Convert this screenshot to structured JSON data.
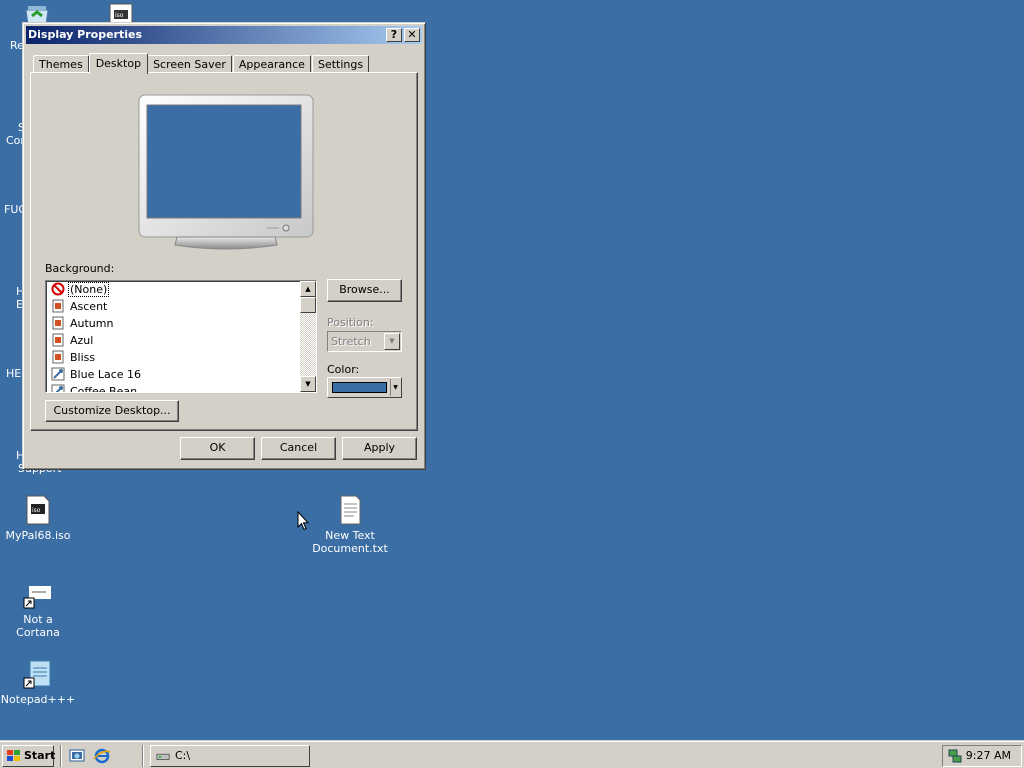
{
  "desktop": {
    "partial_labels": {
      "recycle": "Re",
      "computer_a": "S",
      "computer_b": "Com",
      "fug": "FUG",
      "h_a": "H",
      "h_b": "E",
      "hec": "HEC",
      "help_a": "H",
      "help_b": "Support"
    },
    "icons": {
      "mypal": "MyPal68.iso",
      "newtext_line1": "New Text",
      "newtext_line2": "Document.txt",
      "cortana": "Not a Cortana",
      "notepad": "Notepad+++"
    }
  },
  "window": {
    "title": "Display Properties",
    "help_btn": "?",
    "close_btn": "✕",
    "tabs": [
      "Themes",
      "Desktop",
      "Screen Saver",
      "Appearance",
      "Settings"
    ],
    "active_tab": "Desktop",
    "background_label": "Background:",
    "background_items": [
      {
        "label": "(None)",
        "icon": "none-icon"
      },
      {
        "label": "Ascent",
        "icon": "image-icon"
      },
      {
        "label": "Autumn",
        "icon": "image-icon"
      },
      {
        "label": "Azul",
        "icon": "image-icon"
      },
      {
        "label": "Bliss",
        "icon": "image-icon"
      },
      {
        "label": "Blue Lace 16",
        "icon": "bitmap-icon"
      },
      {
        "label": "Coffee Bean",
        "icon": "bitmap-icon"
      }
    ],
    "selected_background": "(None)",
    "browse_btn": "Browse...",
    "position_label": "Position:",
    "position_value": "Stretch",
    "color_label": "Color:",
    "color_value": "#3a6ea5",
    "customize_btn": "Customize Desktop...",
    "ok_btn": "OK",
    "cancel_btn": "Cancel",
    "apply_btn": "Apply"
  },
  "taskbar": {
    "start_label": "Start",
    "task_label": "C:\\",
    "clock": "9:27 AM"
  },
  "colors": {
    "desktop": "#3a6ea5",
    "title_start": "#0a246a",
    "title_end": "#a6caf0",
    "face": "#d4d0c8"
  }
}
